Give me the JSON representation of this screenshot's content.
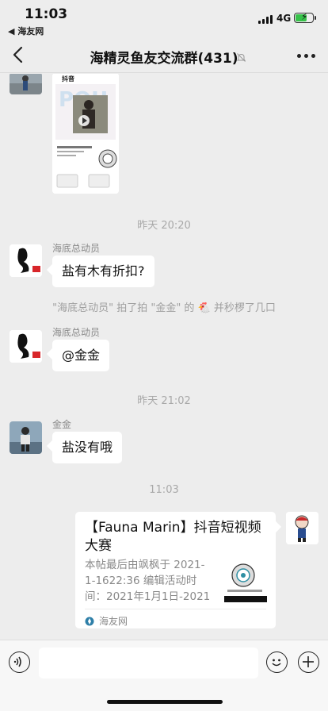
{
  "status": {
    "time": "11:03",
    "back_app": "◀ 海友网",
    "network": "4G",
    "battery_level": 0.65,
    "charging_icon": "bolt-icon"
  },
  "nav": {
    "title": "海精灵鱼友交流群(431)",
    "back_icon": "chevron-left-icon",
    "mute_icon": "bell-off-icon",
    "more_icon": "more-icon"
  },
  "video_card": {
    "app_label": "抖音"
  },
  "timestamps": {
    "t1": "昨天 20:20",
    "t2": "昨天 21:02",
    "t3": "11:03"
  },
  "messages": [
    {
      "sender": "海底总动员",
      "text": "盐有木有折扣?"
    },
    {
      "system": "\"海底总动员\" 拍了拍 \"金金\" 的 🐔 并秒椤了几口"
    },
    {
      "sender": "海底总动员",
      "text": "@金金"
    },
    {
      "sender": "金金",
      "text": "盐没有哦"
    }
  ],
  "link_card": {
    "title": "【Fauna Marin】抖音短视频大赛",
    "description": "本帖最后由飒枫于 2021-1-1622:36 编辑活动时间：2021年1月1日-2021年...",
    "source": "海友网"
  },
  "toolbar": {
    "voice_icon": "voice-icon",
    "emoji_icon": "emoji-icon",
    "plus_icon": "plus-icon"
  }
}
